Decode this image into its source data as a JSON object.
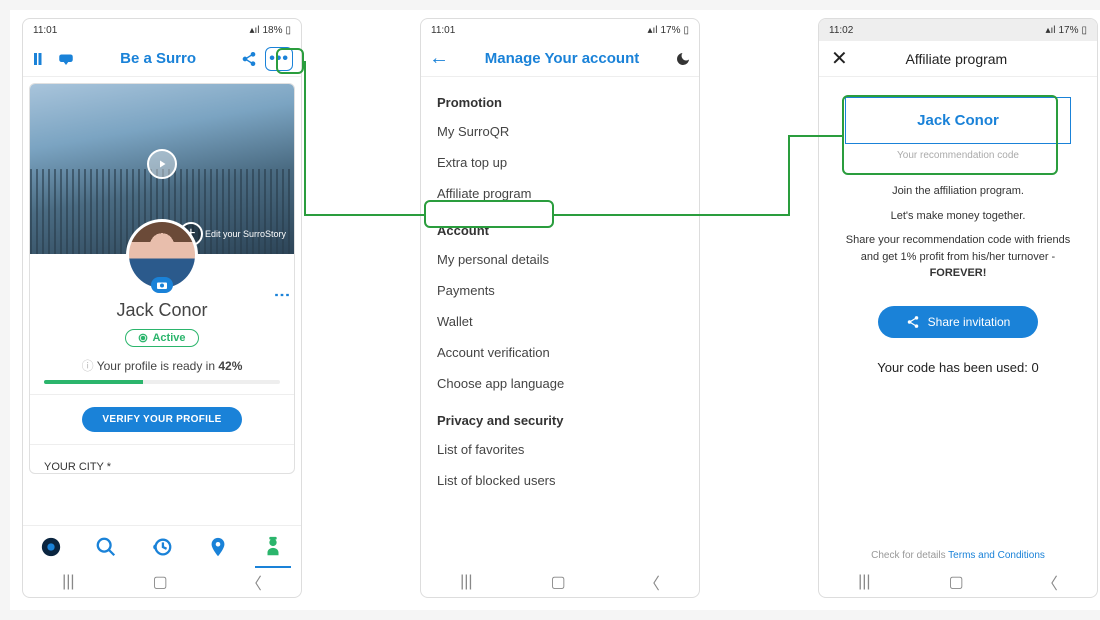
{
  "statusbar": {
    "time1": "11:01",
    "time2": "11:01",
    "time3": "11:02",
    "icons": "⬆ ⬇ ⟁ ⋯",
    "signal": "📶",
    "battery1": "18%",
    "battery2": "17%",
    "battery3": "17%"
  },
  "screen1": {
    "title": "Be a Surro",
    "edit_story": "Edit your SurroStory",
    "name": "Jack Conor",
    "active": "Active",
    "ready_pre": "Your profile is ready in ",
    "ready_pct": "42%",
    "verify": "VERIFY YOUR PROFILE",
    "city": "YOUR CITY *"
  },
  "screen2": {
    "title": "Manage Your account",
    "sections": {
      "promotion": {
        "header": "Promotion",
        "items": [
          "My SurroQR",
          "Extra top up",
          "Affiliate program"
        ]
      },
      "account": {
        "header": "Account",
        "items": [
          "My personal details",
          "Payments",
          "Wallet",
          "Account verification",
          "Choose app language"
        ]
      },
      "privacy": {
        "header": "Privacy and security",
        "items": [
          "List of favorites",
          "List of blocked users"
        ]
      }
    }
  },
  "screen3": {
    "title": "Affiliate program",
    "code": "Jack Conor",
    "code_hint": "Your recommendation code",
    "line1": "Join the affiliation program.",
    "line2": "Let's make money together.",
    "line3_a": "Share your recommendation code with friends and get 1% profit from his/her turnover - ",
    "line3_b": "FOREVER!",
    "share": "Share invitation",
    "used_pre": "Your code has been used: ",
    "used_n": "0",
    "tandc_pre": "Check for details ",
    "tandc_link": "Terms and Conditions"
  }
}
